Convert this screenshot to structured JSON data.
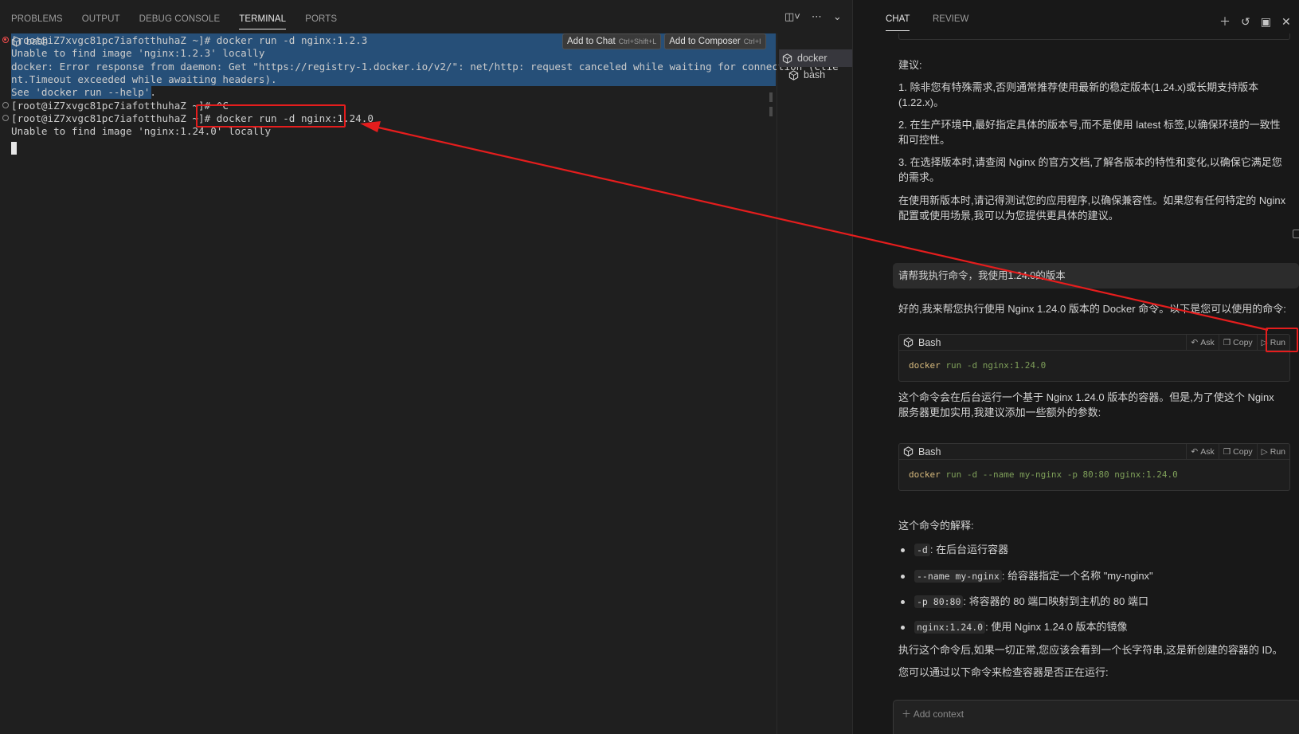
{
  "panel_tabs": [
    "PROBLEMS",
    "OUTPUT",
    "DEBUG CONSOLE",
    "TERMINAL",
    "PORTS"
  ],
  "panel_active_tab": "TERMINAL",
  "terminal": {
    "lines": [
      "[root@iZ7xvgc81pc7iafotthuhaZ ~]# docker run -d nginx:1.2.3",
      "Unable to find image 'nginx:1.2.3' locally",
      "docker: Error response from daemon: Get \"https://registry-1.docker.io/v2/\": net/http: request canceled while waiting for connection (Clie",
      "nt.Timeout exceeded while awaiting headers).",
      "See 'docker run --help'.",
      "[root@iZ7xvgc81pc7iafotthuhaZ ~]# ^C",
      "[root@iZ7xvgc81pc7iafotthuhaZ ~]# docker run -d nginx:1.24.0",
      "Unable to find image 'nginx:1.24.0' locally"
    ],
    "hover_buttons": [
      {
        "label": "Add to Chat",
        "shortcut": "Ctrl+Shift+L"
      },
      {
        "label": "Add to Composer",
        "shortcut": "Ctrl+I"
      }
    ]
  },
  "terminal_list": [
    "bash",
    "docker",
    "bash"
  ],
  "terminal_list_active": "docker",
  "chat": {
    "tabs": [
      "CHAT",
      "REVIEW"
    ],
    "suggest_heading": "建议:",
    "suggestions": [
      "1. 除非您有特殊需求,否则通常推荐使用最新的稳定版本(1.24.x)或长期支持版本(1.22.x)。",
      "2. 在生产环境中,最好指定具体的版本号,而不是使用 latest 标签,以确保环境的一致性和可控性。",
      "3. 在选择版本时,请查阅 Nginx 的官方文档,了解各版本的特性和变化,以确保它满足您的需求。"
    ],
    "latest_code": "latest",
    "closing": "在使用新版本时,请记得测试您的应用程序,以确保兼容性。如果您有任何特定的 Nginx 配置或使用场景,我可以为您提供更具体的建议。",
    "user_message": "请帮我执行命令，我使用1.24.0的版本",
    "reply_intro": "好的,我来帮您执行使用 Nginx 1.24.0 版本的 Docker 命令。以下是您可以使用的命令:",
    "code_blocks": [
      {
        "lang": "Bash",
        "cmd": "docker",
        "args": " run -d nginx:1.24.0"
      },
      {
        "lang": "Bash",
        "cmd": "docker",
        "args": " run -d --name my-nginx -p 80:80 nginx:1.24.0"
      }
    ],
    "code_actions": {
      "ask": "Ask",
      "copy": "Copy",
      "run": "Run"
    },
    "explain1": "这个命令会在后台运行一个基于 Nginx 1.24.0 版本的容器。但是,为了使这个 Nginx 服务器更加实用,我建议添加一些额外的参数:",
    "explain_heading": "这个命令的解释:",
    "bullets": [
      {
        "code": "-d",
        "text": ": 在后台运行容器"
      },
      {
        "code": "--name my-nginx",
        "text": ": 给容器指定一个名称 \"my-nginx\""
      },
      {
        "code": "-p 80:80",
        "text": ": 将容器的 80 端口映射到主机的 80 端口"
      },
      {
        "code": "nginx:1.24.0",
        "text": ": 使用 Nginx 1.24.0 版本的镜像"
      }
    ],
    "after1": "执行这个命令后,如果一切正常,您应该会看到一个长字符串,这是新创建的容器的 ID。",
    "after2": "您可以通过以下命令来检查容器是否正在运行:",
    "add_context": "Add context"
  },
  "colors": {
    "selection": "#264f78",
    "annotation_red": "#e51d1d",
    "panel_bg": "#1f1f1f",
    "chat_bg": "#181818"
  }
}
